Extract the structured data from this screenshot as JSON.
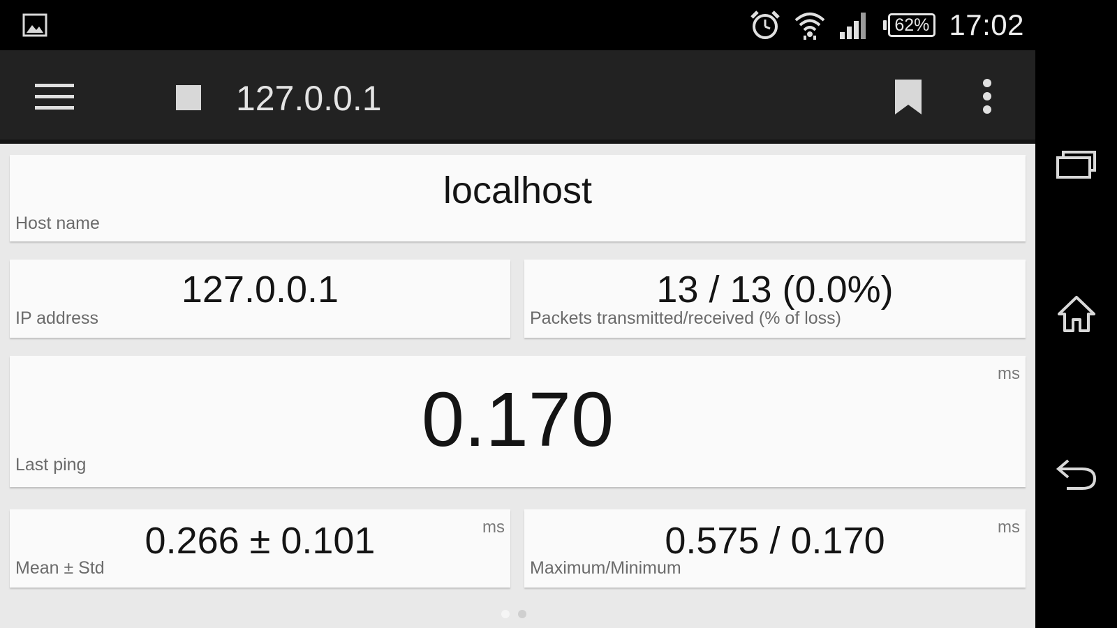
{
  "status_bar": {
    "time": "17:02",
    "battery_percent": "62%",
    "icons": [
      "picture-icon",
      "alarm-icon",
      "wifi-icon",
      "signal-icon",
      "battery-icon"
    ]
  },
  "action_bar": {
    "title": "127.0.0.1",
    "icons": [
      "menu-icon",
      "stop-icon",
      "bookmark-icon",
      "overflow-menu-icon"
    ]
  },
  "cards": {
    "host_name": {
      "value": "localhost",
      "label": "Host name"
    },
    "ip_address": {
      "value": "127.0.0.1",
      "label": "IP address"
    },
    "packets": {
      "value": "13 / 13 (0.0%)",
      "label": "Packets transmitted/received (% of loss)"
    },
    "last_ping": {
      "value": "0.170",
      "label": "Last ping",
      "unit": "ms"
    },
    "mean_std": {
      "value": "0.266 ± 0.101",
      "label": "Mean ± Std",
      "unit": "ms"
    },
    "max_min": {
      "value": "0.575 / 0.170",
      "label": "Maximum/Minimum",
      "unit": "ms"
    }
  },
  "pager": {
    "pages": 2,
    "active_page": 1
  },
  "nav_bar": {
    "icons": [
      "recent-apps-icon",
      "home-icon",
      "back-icon"
    ]
  },
  "colors": {
    "action_bar": "#222222",
    "content_background": "#e9e9e9",
    "card_background": "#fafafa"
  }
}
